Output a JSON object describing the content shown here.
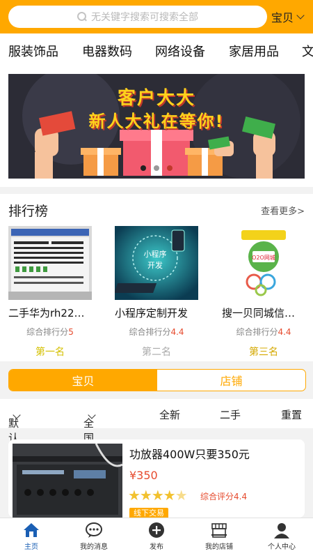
{
  "search": {
    "placeholder": "无关键字搜索可搜索全部",
    "type_select": "宝贝"
  },
  "categories": [
    "服装饰品",
    "电器数码",
    "网络设备",
    "家居用品",
    "文"
  ],
  "banner": {
    "line1": "客户大大",
    "line2": "新人大礼在等你!"
  },
  "ranking": {
    "title": "排行榜",
    "more": "查看更多>",
    "score_label": "综合排行分",
    "items": [
      {
        "name": "二手华为rh22…",
        "score": "5",
        "position": "第一名"
      },
      {
        "name": "小程序定制开发",
        "score": "4.4",
        "position": "第二名"
      },
      {
        "name": "搜一贝同城信…",
        "score": "4.4",
        "position": "第三名"
      }
    ],
    "thumb_text": {
      "mini_program": "小程序 开发",
      "o2o": "O2O网城"
    }
  },
  "segment": {
    "left": "宝贝",
    "right": "店铺"
  },
  "filters": [
    "默认",
    "全国",
    "全新",
    "二手",
    "重置"
  ],
  "product": {
    "title": "功放器400W只要350元",
    "price": "¥350",
    "rating": 4.4,
    "score_label": "综合评分4.4",
    "badge": "线下交易"
  },
  "tabbar": [
    {
      "label": "主页",
      "icon": "home-icon"
    },
    {
      "label": "我的消息",
      "icon": "message-icon"
    },
    {
      "label": "发布",
      "icon": "publish-icon"
    },
    {
      "label": "我的店铺",
      "icon": "shop-icon"
    },
    {
      "label": "个人中心",
      "icon": "user-icon"
    }
  ],
  "colors": {
    "accent": "#ffa800",
    "price": "#e64b2e",
    "active_tab": "#1a5fb4"
  }
}
